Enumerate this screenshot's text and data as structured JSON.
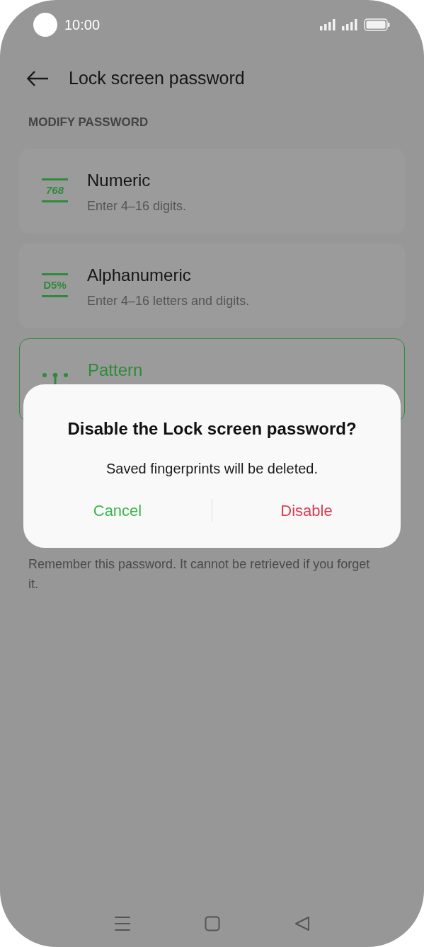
{
  "status_bar": {
    "time": "10:00"
  },
  "header": {
    "title": "Lock screen password"
  },
  "section_label": "MODIFY PASSWORD",
  "options": [
    {
      "kind": "numeric",
      "icon_text": "768",
      "title": "Numeric",
      "subtitle": "Enter 4–16 digits.",
      "selected": false
    },
    {
      "kind": "alphanumeric",
      "icon_text": "D5%",
      "title": "Alphanumeric",
      "subtitle": "Enter 4–16 letters and digits.",
      "selected": false
    },
    {
      "kind": "pattern",
      "title": "Pattern",
      "selected": true
    }
  ],
  "hint": "Remember this password. It cannot be retrieved if you forget it.",
  "dialog": {
    "title": "Disable the Lock screen password?",
    "message": "Saved fingerprints will be deleted.",
    "buttons": [
      {
        "kind": "cancel",
        "label": "Cancel"
      },
      {
        "kind": "destructive",
        "label": "Disable"
      }
    ]
  }
}
